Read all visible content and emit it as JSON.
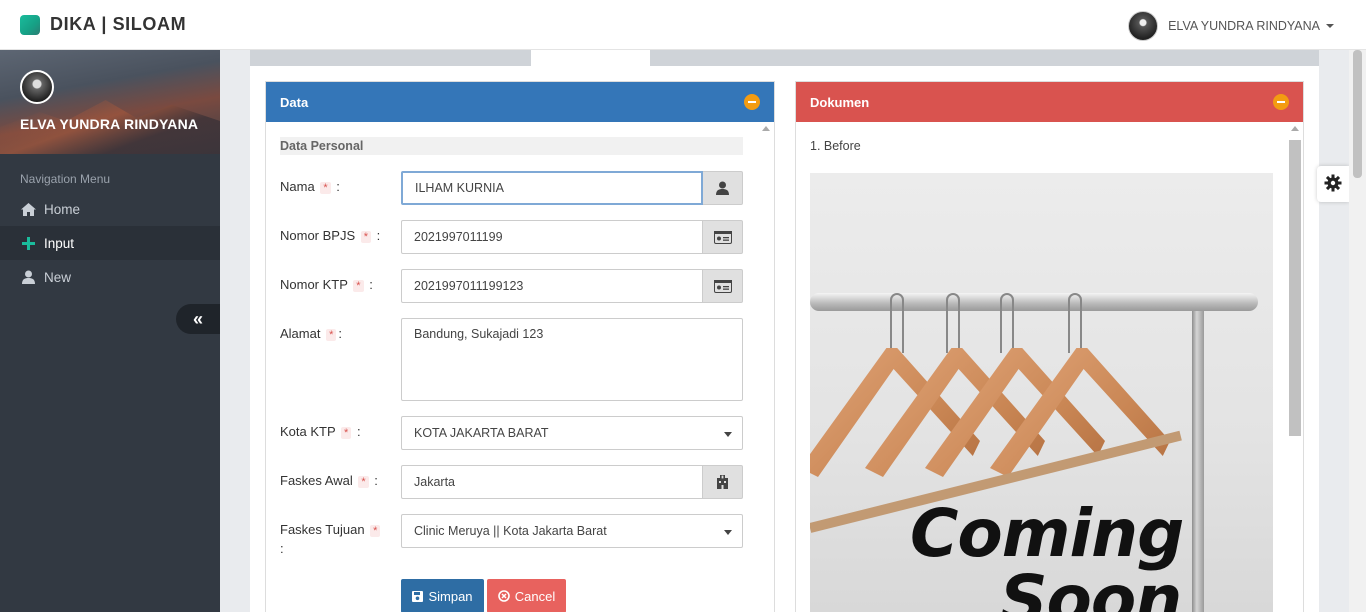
{
  "app": {
    "brand": "DIKA | SILOAM",
    "user": "ELVA YUNDRA RINDYANA"
  },
  "sidebar": {
    "profile_name": "ELVA YUNDRA RINDYANA",
    "nav_header": "Navigation Menu",
    "items": [
      {
        "label": "Home",
        "icon": "home-icon"
      },
      {
        "label": "Input",
        "icon": "plus-icon",
        "active": true
      },
      {
        "label": "New",
        "icon": "user-icon"
      }
    ]
  },
  "data_panel": {
    "title": "Data",
    "section": "Data Personal",
    "required_mark": "*",
    "colon": ":",
    "fields": {
      "nama": {
        "label": "Nama",
        "value": "ILHAM KURNIA"
      },
      "bpjs": {
        "label": "Nomor BPJS",
        "value": "2021997011199"
      },
      "ktp": {
        "label": "Nomor KTP",
        "value": "2021997011199123"
      },
      "alamat": {
        "label": "Alamat",
        "value": "Bandung, Sukajadi 123"
      },
      "kota_ktp": {
        "label": "Kota KTP",
        "value": "KOTA JAKARTA BARAT"
      },
      "faskes_awal": {
        "label": "Faskes Awal",
        "value": "Jakarta"
      },
      "faskes_tujuan": {
        "label": "Faskes Tujuan",
        "value": "Clinic Meruya || Kota Jakarta Barat"
      }
    },
    "buttons": {
      "save": "Simpan",
      "cancel": "Cancel"
    }
  },
  "doc_panel": {
    "title": "Dokumen",
    "item_label": "1. Before",
    "image_text_1": "Coming",
    "image_text_2": "Soon"
  },
  "colors": {
    "data_header": "#3476b8",
    "doc_header": "#d9534f",
    "minimize": "#f39c12",
    "sidebar": "#323942"
  }
}
